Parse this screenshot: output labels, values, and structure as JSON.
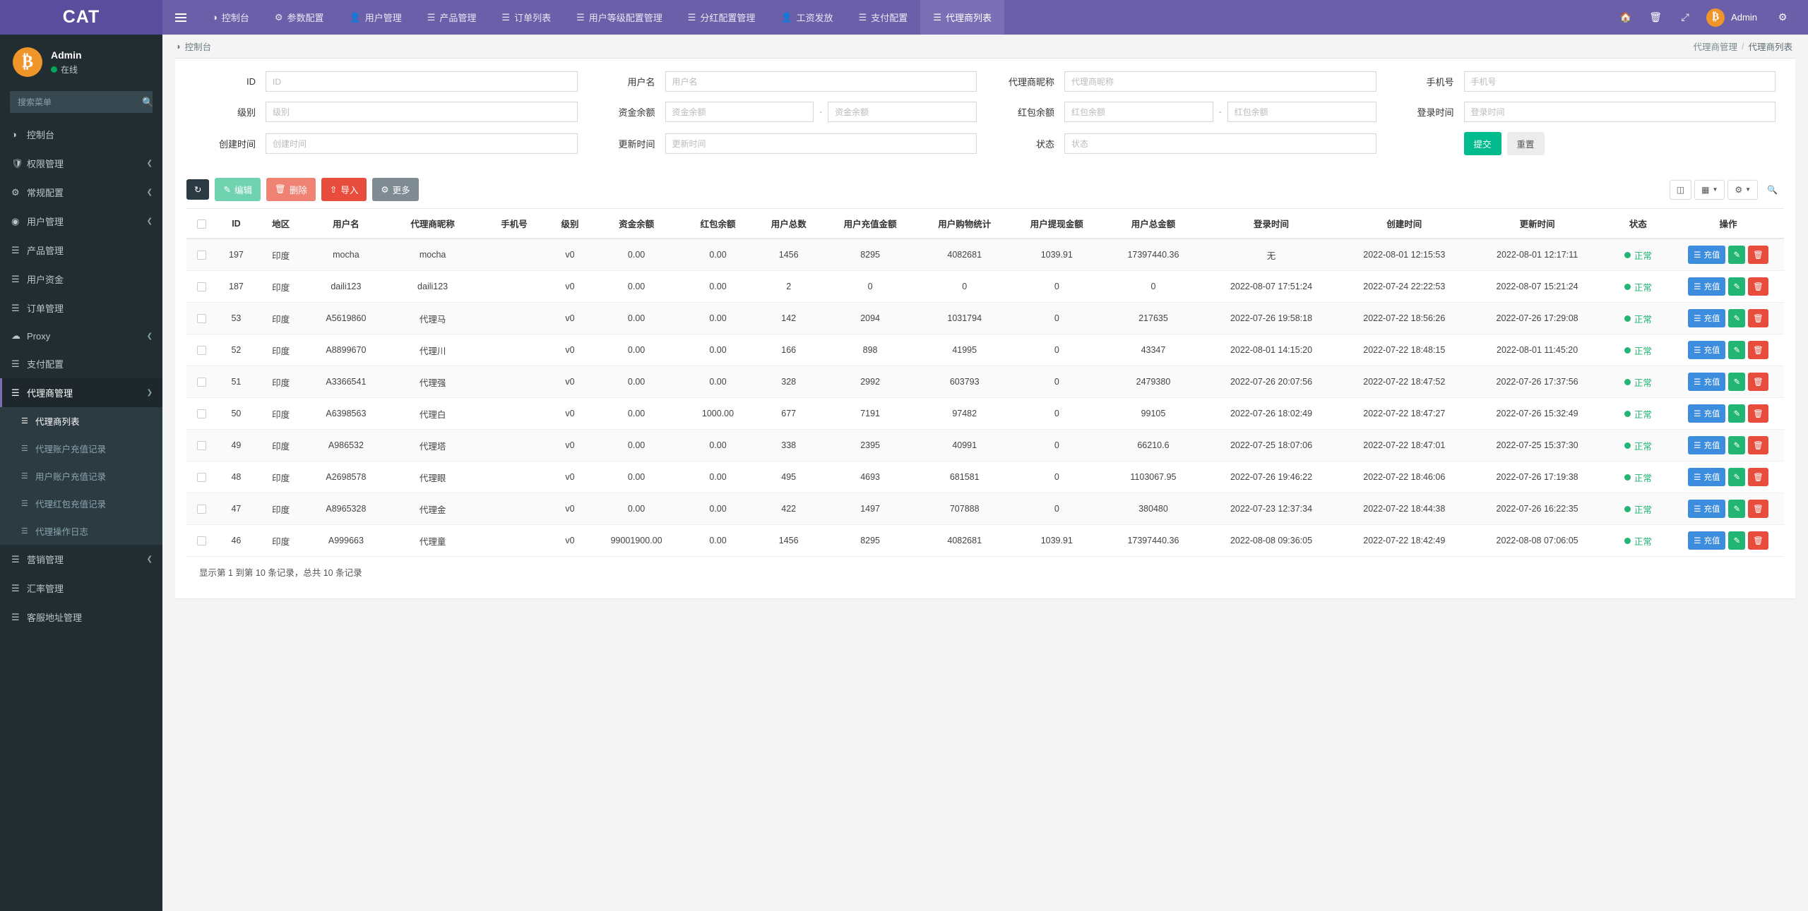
{
  "brand": {
    "title": "CAT"
  },
  "topnav": {
    "menu_icon": "hamburger-icon",
    "items": [
      {
        "label": "控制台",
        "icon": "dashboard-icon",
        "active": false
      },
      {
        "label": "参数配置",
        "icon": "gear-icon",
        "active": false
      },
      {
        "label": "用户管理",
        "icon": "user-icon",
        "active": false
      },
      {
        "label": "产品管理",
        "icon": "list-icon",
        "active": false
      },
      {
        "label": "订单列表",
        "icon": "list-icon",
        "active": false
      },
      {
        "label": "用户等级配置管理",
        "icon": "list-icon",
        "active": false
      },
      {
        "label": "分红配置管理",
        "icon": "list-icon",
        "active": false
      },
      {
        "label": "工资发放",
        "icon": "user-icon",
        "active": false
      },
      {
        "label": "支付配置",
        "icon": "list-icon",
        "active": false
      },
      {
        "label": "代理商列表",
        "icon": "list-icon",
        "active": true
      }
    ],
    "right_icons": [
      "home-icon",
      "trash-icon",
      "fullscreen-icon"
    ],
    "user_name": "Admin",
    "user_avatar": "bitcoin-icon",
    "settings_icon": "cogs-icon"
  },
  "sidebar": {
    "profile": {
      "name": "Admin",
      "status": "在线",
      "avatar": "bitcoin-icon"
    },
    "search": {
      "placeholder": "搜索菜单",
      "value": "",
      "icon": "search-icon"
    },
    "items": [
      {
        "label": "控制台",
        "icon": "dashboard-icon",
        "caret": false,
        "active": false
      },
      {
        "label": "权限管理",
        "icon": "shield-icon",
        "caret": true,
        "active": false
      },
      {
        "label": "常规配置",
        "icon": "cogs-icon",
        "caret": true,
        "active": false
      },
      {
        "label": "用户管理",
        "icon": "user-circle-icon",
        "caret": true,
        "active": false
      },
      {
        "label": "产品管理",
        "icon": "list-icon",
        "caret": false,
        "active": false
      },
      {
        "label": "用户资金",
        "icon": "list-icon",
        "caret": false,
        "active": false
      },
      {
        "label": "订单管理",
        "icon": "list-icon",
        "caret": false,
        "active": false
      },
      {
        "label": "Proxy",
        "icon": "cloud-icon",
        "caret": true,
        "active": false
      },
      {
        "label": "支付配置",
        "icon": "list-icon",
        "caret": false,
        "active": false
      },
      {
        "label": "代理商管理",
        "icon": "list-icon",
        "caret": true,
        "active": true
      }
    ],
    "submenu": [
      {
        "label": "代理商列表",
        "icon": "list-icon",
        "active": true
      },
      {
        "label": "代理账户充值记录",
        "icon": "list-icon",
        "active": false
      },
      {
        "label": "用户账户充值记录",
        "icon": "list-icon",
        "active": false
      },
      {
        "label": "代理红包充值记录",
        "icon": "list-icon",
        "active": false
      },
      {
        "label": "代理操作日志",
        "icon": "list-icon",
        "active": false
      }
    ],
    "items_after": [
      {
        "label": "营销管理",
        "icon": "list-icon",
        "caret": true,
        "active": false
      },
      {
        "label": "汇率管理",
        "icon": "list-icon",
        "caret": false,
        "active": false
      },
      {
        "label": "客服地址管理",
        "icon": "list-icon",
        "caret": false,
        "active": false
      }
    ]
  },
  "breadcrumb": {
    "home_icon": "dashboard-icon",
    "home_label": "控制台",
    "trail_parent": "代理商管理",
    "trail_sep": "/",
    "trail_current": "代理商列表"
  },
  "filter": {
    "fields": [
      {
        "label": "ID",
        "placeholder": "ID",
        "value": "",
        "type": "text",
        "name": "id"
      },
      {
        "label": "用户名",
        "placeholder": "用户名",
        "value": "",
        "type": "text",
        "name": "username"
      },
      {
        "label": "代理商昵称",
        "placeholder": "代理商昵称",
        "value": "",
        "type": "text",
        "name": "agent-nickname"
      },
      {
        "label": "手机号",
        "placeholder": "手机号",
        "value": "",
        "type": "text",
        "name": "phone"
      },
      {
        "label": "级别",
        "placeholder": "级别",
        "value": "",
        "type": "text",
        "name": "level"
      },
      {
        "label": "资金余额",
        "placeholder": "资金余额",
        "placeholder2": "资金余额",
        "value": "",
        "value2": "",
        "type": "range",
        "name": "balance"
      },
      {
        "label": "红包余额",
        "placeholder": "红包余额",
        "placeholder2": "红包余额",
        "value": "",
        "value2": "",
        "type": "range",
        "name": "red-packet-balance"
      },
      {
        "label": "登录时间",
        "placeholder": "登录时间",
        "value": "",
        "type": "text",
        "name": "login-time"
      },
      {
        "label": "创建时间",
        "placeholder": "创建时间",
        "value": "",
        "type": "text",
        "name": "create-time"
      },
      {
        "label": "更新时间",
        "placeholder": "更新时间",
        "value": "",
        "type": "text",
        "name": "update-time"
      },
      {
        "label": "状态",
        "placeholder": "状态",
        "value": "",
        "type": "text",
        "name": "status"
      }
    ],
    "submit_label": "提交",
    "reset_label": "重置",
    "range_sep": "-"
  },
  "toolbar": {
    "refresh_icon": "refresh-icon",
    "edit_label": "编辑",
    "edit_icon": "pencil-icon",
    "delete_label": "删除",
    "delete_icon": "trash-icon",
    "import_label": "导入",
    "import_icon": "upload-icon",
    "more_label": "更多",
    "more_icon": "gear-icon",
    "right_icons": [
      "columns-icon",
      "grid-icon",
      "wrench-icon",
      "search-icon"
    ]
  },
  "table": {
    "columns": [
      "",
      "ID",
      "地区",
      "用户名",
      "代理商昵称",
      "手机号",
      "级别",
      "资金余额",
      "红包余额",
      "用户总数",
      "用户充值金额",
      "用户购物统计",
      "用户提现金额",
      "用户总金额",
      "登录时间",
      "创建时间",
      "更新时间",
      "状态",
      "操作"
    ],
    "rows": [
      {
        "id": "197",
        "region": "印度",
        "username": "mocha",
        "nickname": "mocha",
        "phone": "",
        "level": "v0",
        "balance": "0.00",
        "red": "0.00",
        "users": "1456",
        "recharge": "8295",
        "shopping": "4082681",
        "withdraw": "1039.91",
        "total": "17397440.36",
        "login_time": "无",
        "create_time": "2022-08-01 12:15:53",
        "update_time": "2022-08-01 12:17:11",
        "status": "正常"
      },
      {
        "id": "187",
        "region": "印度",
        "username": "daili123",
        "nickname": "daili123",
        "phone": "",
        "level": "v0",
        "balance": "0.00",
        "red": "0.00",
        "users": "2",
        "recharge": "0",
        "shopping": "0",
        "withdraw": "0",
        "total": "0",
        "login_time": "2022-08-07 17:51:24",
        "create_time": "2022-07-24 22:22:53",
        "update_time": "2022-08-07 15:21:24",
        "status": "正常"
      },
      {
        "id": "53",
        "region": "印度",
        "username": "A5619860",
        "nickname": "代理马",
        "phone": "",
        "level": "v0",
        "balance": "0.00",
        "red": "0.00",
        "users": "142",
        "recharge": "2094",
        "shopping": "1031794",
        "withdraw": "0",
        "total": "217635",
        "login_time": "2022-07-26 19:58:18",
        "create_time": "2022-07-22 18:56:26",
        "update_time": "2022-07-26 17:29:08",
        "status": "正常"
      },
      {
        "id": "52",
        "region": "印度",
        "username": "A8899670",
        "nickname": "代理川",
        "phone": "",
        "level": "v0",
        "balance": "0.00",
        "red": "0.00",
        "users": "166",
        "recharge": "898",
        "shopping": "41995",
        "withdraw": "0",
        "total": "43347",
        "login_time": "2022-08-01 14:15:20",
        "create_time": "2022-07-22 18:48:15",
        "update_time": "2022-08-01 11:45:20",
        "status": "正常"
      },
      {
        "id": "51",
        "region": "印度",
        "username": "A3366541",
        "nickname": "代理强",
        "phone": "",
        "level": "v0",
        "balance": "0.00",
        "red": "0.00",
        "users": "328",
        "recharge": "2992",
        "shopping": "603793",
        "withdraw": "0",
        "total": "2479380",
        "login_time": "2022-07-26 20:07:56",
        "create_time": "2022-07-22 18:47:52",
        "update_time": "2022-07-26 17:37:56",
        "status": "正常"
      },
      {
        "id": "50",
        "region": "印度",
        "username": "A6398563",
        "nickname": "代理白",
        "phone": "",
        "level": "v0",
        "balance": "0.00",
        "red": "1000.00",
        "users": "677",
        "recharge": "7191",
        "shopping": "97482",
        "withdraw": "0",
        "total": "99105",
        "login_time": "2022-07-26 18:02:49",
        "create_time": "2022-07-22 18:47:27",
        "update_time": "2022-07-26 15:32:49",
        "status": "正常"
      },
      {
        "id": "49",
        "region": "印度",
        "username": "A986532",
        "nickname": "代理塔",
        "phone": "",
        "level": "v0",
        "balance": "0.00",
        "red": "0.00",
        "users": "338",
        "recharge": "2395",
        "shopping": "40991",
        "withdraw": "0",
        "total": "66210.6",
        "login_time": "2022-07-25 18:07:06",
        "create_time": "2022-07-22 18:47:01",
        "update_time": "2022-07-25 15:37:30",
        "status": "正常"
      },
      {
        "id": "48",
        "region": "印度",
        "username": "A2698578",
        "nickname": "代理眼",
        "phone": "",
        "level": "v0",
        "balance": "0.00",
        "red": "0.00",
        "users": "495",
        "recharge": "4693",
        "shopping": "681581",
        "withdraw": "0",
        "total": "1103067.95",
        "login_time": "2022-07-26 19:46:22",
        "create_time": "2022-07-22 18:46:06",
        "update_time": "2022-07-26 17:19:38",
        "status": "正常"
      },
      {
        "id": "47",
        "region": "印度",
        "username": "A8965328",
        "nickname": "代理金",
        "phone": "",
        "level": "v0",
        "balance": "0.00",
        "red": "0.00",
        "users": "422",
        "recharge": "1497",
        "shopping": "707888",
        "withdraw": "0",
        "total": "380480",
        "login_time": "2022-07-23 12:37:34",
        "create_time": "2022-07-22 18:44:38",
        "update_time": "2022-07-26 16:22:35",
        "status": "正常"
      },
      {
        "id": "46",
        "region": "印度",
        "username": "A999663",
        "nickname": "代理童",
        "phone": "",
        "level": "v0",
        "balance": "99001900.00",
        "red": "0.00",
        "users": "1456",
        "recharge": "8295",
        "shopping": "4082681",
        "withdraw": "1039.91",
        "total": "17397440.36",
        "login_time": "2022-08-08 09:36:05",
        "create_time": "2022-07-22 18:42:49",
        "update_time": "2022-08-08 07:06:05",
        "status": "正常"
      }
    ],
    "row_actions": {
      "topup_label": "充值",
      "topup_icon": "list-icon",
      "edit_icon": "pencil-icon",
      "delete_icon": "trash-icon"
    },
    "footer_info": "显示第 1 到第 10 条记录，总共 10 条记录"
  },
  "colors": {
    "brand_purple": "#5b4d9e",
    "nav_purple": "#6a5fa8",
    "sidebar_dark": "#222d32",
    "accent_green": "#00bc8c",
    "status_green": "#22b573",
    "danger_red": "#e74c3c",
    "bitcoin_orange": "#f0952a",
    "primary_blue": "#3c8dde"
  }
}
